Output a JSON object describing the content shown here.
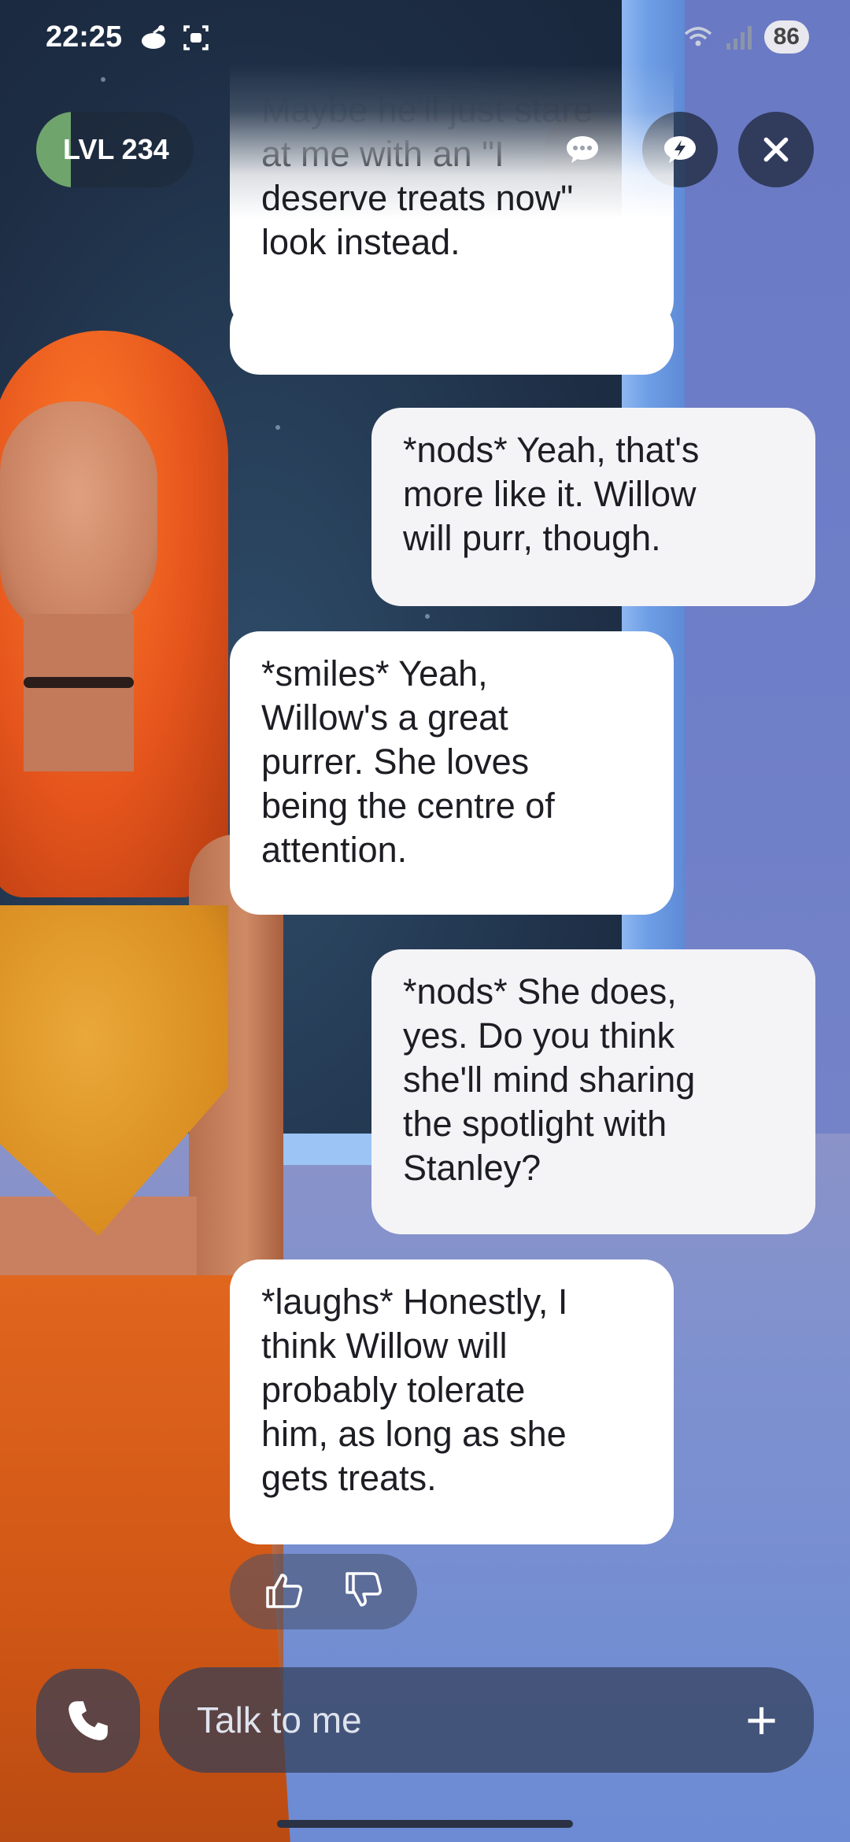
{
  "status_bar": {
    "time": "22:25",
    "battery": "86",
    "icons": [
      "reddit-icon",
      "screen-record-icon",
      "wifi-icon",
      "signal-icon"
    ]
  },
  "header": {
    "level_label": "LVL 234",
    "level_color": "#6fa56c",
    "buttons": [
      "chat-icon",
      "quick-reply-icon",
      "close-icon"
    ]
  },
  "chat": {
    "faded_message": "Maybe he'll just stare\nat me with an \"I\ndeserve treats now\"\nlook instead.",
    "messages": [
      {
        "role": "user",
        "text": "*nods* Yeah, that's\nmore like it. Willow\nwill purr, though."
      },
      {
        "role": "ai",
        "text": "*smiles* Yeah,\nWillow's a great\npurrer. She loves\nbeing the centre of\nattention."
      },
      {
        "role": "user",
        "text": "*nods* She does,\nyes. Do you think\nshe'll mind sharing\nthe spotlight with\nStanley?"
      },
      {
        "role": "ai",
        "text": "*laughs* Honestly, I\nthink Willow will\nprobably tolerate\nhim, as long as she\ngets treats."
      }
    ]
  },
  "feedback": {
    "icons": [
      "thumbs-up-icon",
      "thumbs-down-icon"
    ]
  },
  "composer": {
    "placeholder": "Talk to me",
    "plus_label": "+"
  }
}
